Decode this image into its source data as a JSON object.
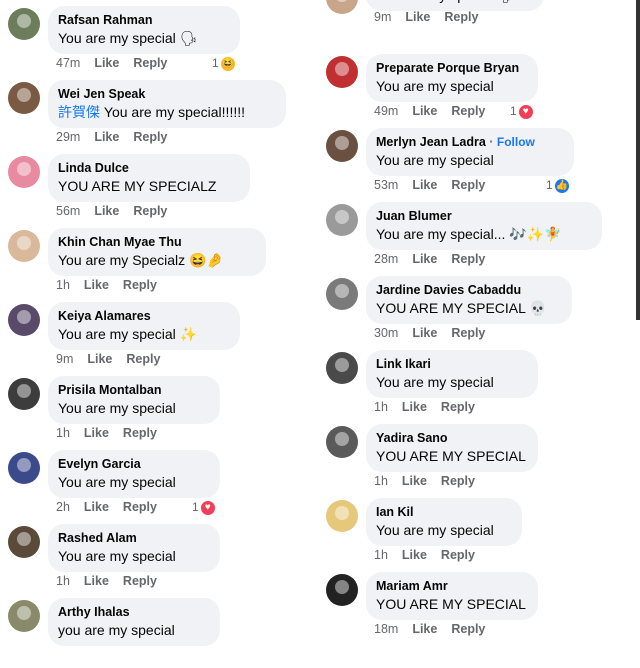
{
  "actions": {
    "like": "Like",
    "reply": "Reply",
    "follow": "Follow"
  },
  "left": [
    {
      "name": "Rafsan Rahman",
      "text": "You are my special 🗣",
      "time": "47m",
      "react": "1",
      "react_icon": "haha"
    },
    {
      "name": "Wei Jen Speak",
      "prefix": "許賀傑",
      "text": " You are my special!!!!!!",
      "time": "29m"
    },
    {
      "name": "Linda Dulce",
      "text": "YOU ARE MY SPECIALZ",
      "time": "56m"
    },
    {
      "name": "Khin Chan Myae Thu",
      "text": "You are my Specialz 😆🤌",
      "time": "1h"
    },
    {
      "name": "Keiya Alamares",
      "text": "You are my special ✨",
      "time": "9m"
    },
    {
      "name": "Prisila Montalban",
      "text": "You are my special",
      "time": "1h"
    },
    {
      "name": "Evelyn Garcia",
      "text": "You are my special",
      "time": "2h",
      "react": "1",
      "react_icon": "love"
    },
    {
      "name": "Rashed Alam",
      "text": "You are my special",
      "time": "1h"
    },
    {
      "name": "Arthy Ihalas",
      "text": "you are my special",
      "time": ""
    }
  ],
  "right": [
    {
      "name": "",
      "text": "You are my special 🗣",
      "time": "9m"
    },
    {
      "name": "Preparate Porque Bryan",
      "text": "You are my special",
      "time": "49m",
      "react": "1",
      "react_icon": "love"
    },
    {
      "name": "Merlyn Jean Ladra",
      "follow": true,
      "text": "You are my special",
      "time": "53m",
      "react": "1",
      "react_icon": "like"
    },
    {
      "name": "Juan Blumer",
      "text": "You are my special... 🎶✨🧚",
      "time": "28m"
    },
    {
      "name": "Jardine Davies Cabaddu",
      "text": "YOU ARE MY SPECIAL 💀",
      "time": "30m"
    },
    {
      "name": "Link Ikari",
      "text": "You are my special",
      "time": "1h"
    },
    {
      "name": "Yadira Sano",
      "text": "YOU ARE MY SPECIAL",
      "time": "1h"
    },
    {
      "name": "Ian Kil",
      "text": "You are my special",
      "time": "1h"
    },
    {
      "name": "Mariam Amr",
      "text": "YOU ARE MY SPECIAL",
      "time": "18m"
    }
  ],
  "avatar_colors": {
    "left": [
      "#6b7d5a",
      "#7a5a43",
      "#e88aa0",
      "#d9b99a",
      "#5a4a6a",
      "#3d3d3d",
      "#3a4a8a",
      "#5a4a3a",
      "#8a8a6a"
    ],
    "right": [
      "#c9a58a",
      "#c03030",
      "#6a5040",
      "#9a9a9a",
      "#7a7a7a",
      "#4a4a4a",
      "#5a5a5a",
      "#e6c87a",
      "#222222"
    ]
  },
  "colors": {
    "haha": "#f7b928",
    "love": "#f33e58",
    "like": "#1877f2"
  }
}
